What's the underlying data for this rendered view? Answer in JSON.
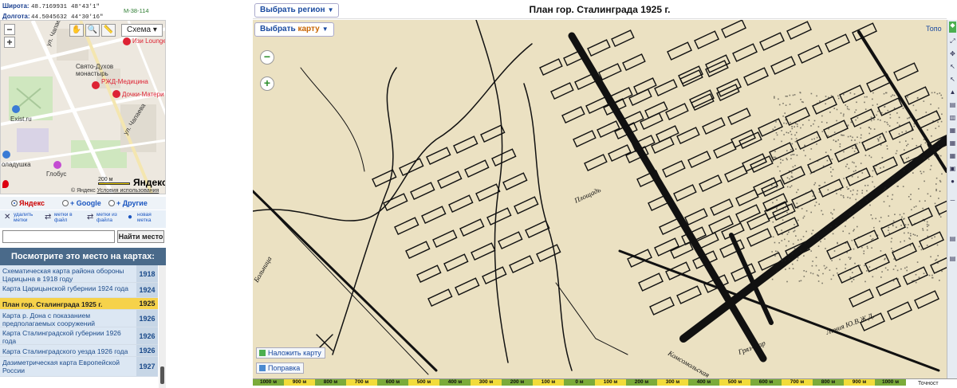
{
  "coords": {
    "lat_label": "Широта:",
    "lat_value": "48.7169931",
    "lat_dms": "48°43'1\"",
    "lon_label": "Долгота:",
    "lon_value": "44.5045632",
    "lon_dms": "44°30'16\"",
    "sheet_code": "M-38-114"
  },
  "minimap": {
    "scheme_label": "Схема",
    "zoom_in": "+",
    "zoom_out": "−",
    "labels": [
      {
        "text": "Изи Lounge",
        "cls": "red",
        "poi": "#d23"
      },
      {
        "text": "Свято-Духов монастырь",
        "cls": "",
        "poi": ""
      },
      {
        "text": "РЖД-Медицина",
        "cls": "red",
        "poi": "#d23"
      },
      {
        "text": "Дочки-Матери",
        "cls": "red",
        "poi": "#d23"
      },
      {
        "text": "Exist.ru",
        "cls": "",
        "poi": "#3a7bd5"
      },
      {
        "text": "Глобус",
        "cls": "",
        "poi": "#c44cd2"
      },
      {
        "text": "оладушка",
        "cls": "",
        "poi": "#3a7bd5"
      },
      {
        "text": "ул. Чапаева",
        "cls": "",
        "poi": ""
      },
      {
        "text": "ул. Чапаева",
        "cls": "",
        "poi": ""
      }
    ],
    "scale_text": "200 м",
    "brand": "Яндекс",
    "copyright": "© Яндекс",
    "terms": "Условия использования"
  },
  "radios": [
    {
      "label": "Яндекс",
      "selected": true
    },
    {
      "label": "Google",
      "selected": false
    },
    {
      "label": "Другие",
      "selected": false
    }
  ],
  "actions": [
    {
      "icon": "✕",
      "label": "удалить метки"
    },
    {
      "icon": "⇄",
      "label": "метки в файл"
    },
    {
      "icon": "⇄",
      "label": "метки из файла"
    },
    {
      "icon": "●",
      "label": "новая метка"
    }
  ],
  "search": {
    "value": "",
    "button": "Найти место"
  },
  "list_header": "Посмотрите это место на картах:",
  "maps": [
    {
      "title": "Схематическая карта района обороны Царицына в 1918 году",
      "year": "1918",
      "active": false
    },
    {
      "title": "Карта Царицынской губернии 1924 года",
      "year": "1924",
      "active": false
    },
    {
      "title": "План гор. Сталинграда 1925 г.",
      "year": "1925",
      "active": true
    },
    {
      "title": "Карта р. Дона с показанием предполагаемых сооружений",
      "year": "1926",
      "active": false
    },
    {
      "title": "Карта Сталинградской губернии 1926 года",
      "year": "1926",
      "active": false
    },
    {
      "title": "Карта Сталинградского уезда 1926 года",
      "year": "1926",
      "active": false
    },
    {
      "title": "Дазиметрическая карта Европейской России",
      "year": "1927",
      "active": false
    }
  ],
  "main": {
    "title": "План гор. Сталинграда 1925 г.",
    "region_btn": "Выбрать регион",
    "map_btn_prefix": "Выбрать ",
    "map_btn_accent": "карту",
    "topo": "Топо",
    "overlay_btn": "Наложить карту",
    "edit_btn": "Поправка",
    "zoom_out": "−",
    "zoom_in": "+",
    "scale": [
      "1000 м",
      "900 м",
      "800 м",
      "700 м",
      "600 м",
      "500 м",
      "400 м",
      "300 м",
      "200 м",
      "100 м",
      "0 м",
      "100 м",
      "200 м",
      "300 м",
      "400 м",
      "500 м",
      "600 м",
      "700 м",
      "800 м",
      "900 м",
      "1000 м"
    ],
    "scale_end": "Точност"
  },
  "colors": {
    "accent": "#1a4aa0",
    "active_item": "#f6d24a",
    "header": "#4a6a8a",
    "map_paper": "#ebe1c2",
    "map_ink": "#111111"
  }
}
